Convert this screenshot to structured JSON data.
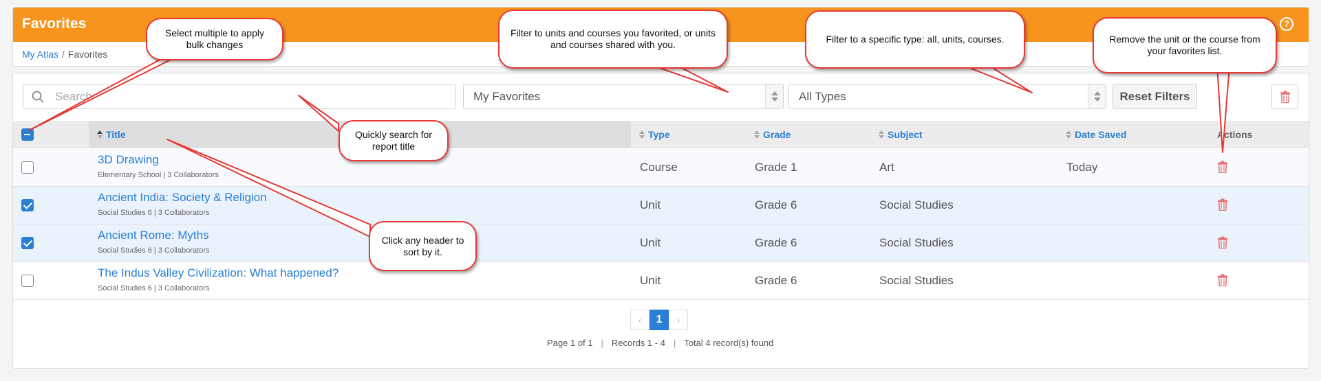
{
  "header": {
    "title": "Favorites",
    "help_icon": "?",
    "accent_color": "#f7941e"
  },
  "breadcrumb": {
    "root": "My Atlas",
    "separator": "/",
    "current": "Favorites"
  },
  "filters": {
    "search_placeholder": "Search",
    "favorites_select": "My Favorites",
    "types_select": "All Types",
    "reset_label": "Reset Filters"
  },
  "columns": {
    "title": "Title",
    "type": "Type",
    "grade": "Grade",
    "subject": "Subject",
    "date_saved": "Date Saved",
    "actions": "Actions"
  },
  "rows": [
    {
      "title": "3D Drawing",
      "sub": "Elementary School | 3 Collaborators",
      "type": "Course",
      "grade": "Grade 1",
      "subject": "Art",
      "date": "Today",
      "checked": false
    },
    {
      "title": "Ancient India: Society & Religion",
      "sub": "Social Studies 6 | 3 Collaborators",
      "type": "Unit",
      "grade": "Grade 6",
      "subject": "Social Studies",
      "date": "",
      "checked": true
    },
    {
      "title": "Ancient Rome: Myths",
      "sub": "Social Studies 6 | 3 Collaborators",
      "type": "Unit",
      "grade": "Grade 6",
      "subject": "Social Studies",
      "date": "",
      "checked": true
    },
    {
      "title": "The Indus Valley Civilization: What happened?",
      "sub": "Social Studies 6 | 3 Collaborators",
      "type": "Unit",
      "grade": "Grade 6",
      "subject": "Social Studies",
      "date": "",
      "checked": false
    }
  ],
  "pagination": {
    "prev": "‹",
    "current": "1",
    "next": "›",
    "page_info": "Page 1 of 1",
    "records": "Records 1 - 4",
    "total": "Total 4 record(s) found"
  },
  "callouts": {
    "bulk": "Select multiple to apply bulk changes",
    "filter_fav": "Filter to units and courses you favorited, or units and courses shared with you.",
    "filter_type": "Filter to a specific type: all, units, courses.",
    "remove": "Remove the unit or the course from your favorites list.",
    "search": "Quickly search for report title",
    "sort": "Click any header to sort by it."
  }
}
